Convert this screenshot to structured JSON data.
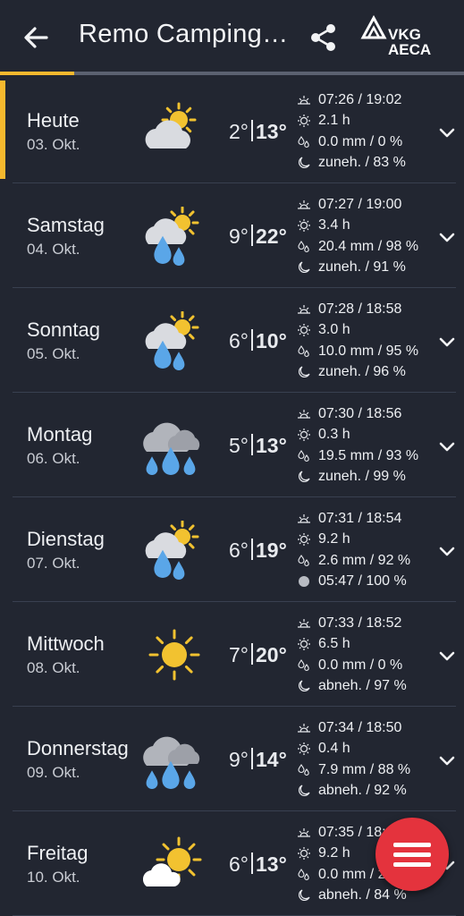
{
  "header": {
    "title": "Remo Camping…",
    "logo_line1": "VKG",
    "logo_line2": "AECA"
  },
  "colors": {
    "accent": "#f5b82e",
    "fab": "#e4333d",
    "background": "#222631"
  },
  "days": [
    {
      "day": "Heute",
      "date": "03. Okt.",
      "icon": "partly-cloudy-icon",
      "min": "2°",
      "max": "13°",
      "sun": "07:26 / 19:02",
      "sunshine": "2.1 h",
      "rain": "0.0 mm / 0 %",
      "moon": "zuneh. / 83 %",
      "moon_icon": "moon-waxing-icon"
    },
    {
      "day": "Samstag",
      "date": "04. Okt.",
      "icon": "sun-cloud-rain-icon",
      "min": "9°",
      "max": "22°",
      "sun": "07:27 / 19:00",
      "sunshine": "3.4 h",
      "rain": "20.4 mm / 98 %",
      "moon": "zuneh. / 91 %",
      "moon_icon": "moon-waxing-icon"
    },
    {
      "day": "Sonntag",
      "date": "05. Okt.",
      "icon": "sun-cloud-rain-icon",
      "min": "6°",
      "max": "10°",
      "sun": "07:28 / 18:58",
      "sunshine": "3.0 h",
      "rain": "10.0 mm / 95 %",
      "moon": "zuneh. / 96 %",
      "moon_icon": "moon-waxing-icon"
    },
    {
      "day": "Montag",
      "date": "06. Okt.",
      "icon": "heavy-rain-icon",
      "min": "5°",
      "max": "13°",
      "sun": "07:30 / 18:56",
      "sunshine": "0.3 h",
      "rain": "19.5 mm / 93 %",
      "moon": "zuneh. / 99 %",
      "moon_icon": "moon-waxing-icon"
    },
    {
      "day": "Dienstag",
      "date": "07. Okt.",
      "icon": "sun-cloud-rain-icon",
      "min": "6°",
      "max": "19°",
      "sun": "07:31 / 18:54",
      "sunshine": "9.2 h",
      "rain": "2.6 mm / 92 %",
      "moon": "05:47 / 100 %",
      "moon_icon": "full-moon-icon"
    },
    {
      "day": "Mittwoch",
      "date": "08. Okt.",
      "icon": "sun-icon",
      "min": "7°",
      "max": "20°",
      "sun": "07:33 / 18:52",
      "sunshine": "6.5 h",
      "rain": "0.0 mm / 0 %",
      "moon": "abneh. / 97 %",
      "moon_icon": "moon-waning-icon"
    },
    {
      "day": "Donnerstag",
      "date": "09. Okt.",
      "icon": "heavy-rain-icon",
      "min": "9°",
      "max": "14°",
      "sun": "07:34 / 18:50",
      "sunshine": "0.4 h",
      "rain": "7.9 mm / 88 %",
      "moon": "abneh. / 92 %",
      "moon_icon": "moon-waning-icon"
    },
    {
      "day": "Freitag",
      "date": "10. Okt.",
      "icon": "sun-behind-cloud-icon",
      "min": "6°",
      "max": "13°",
      "sun": "07:35 / 18:4",
      "sunshine": "9.2 h",
      "rain": "0.0 mm / 2",
      "moon": "abneh. / 84 %",
      "moon_icon": "moon-waning-icon"
    }
  ]
}
